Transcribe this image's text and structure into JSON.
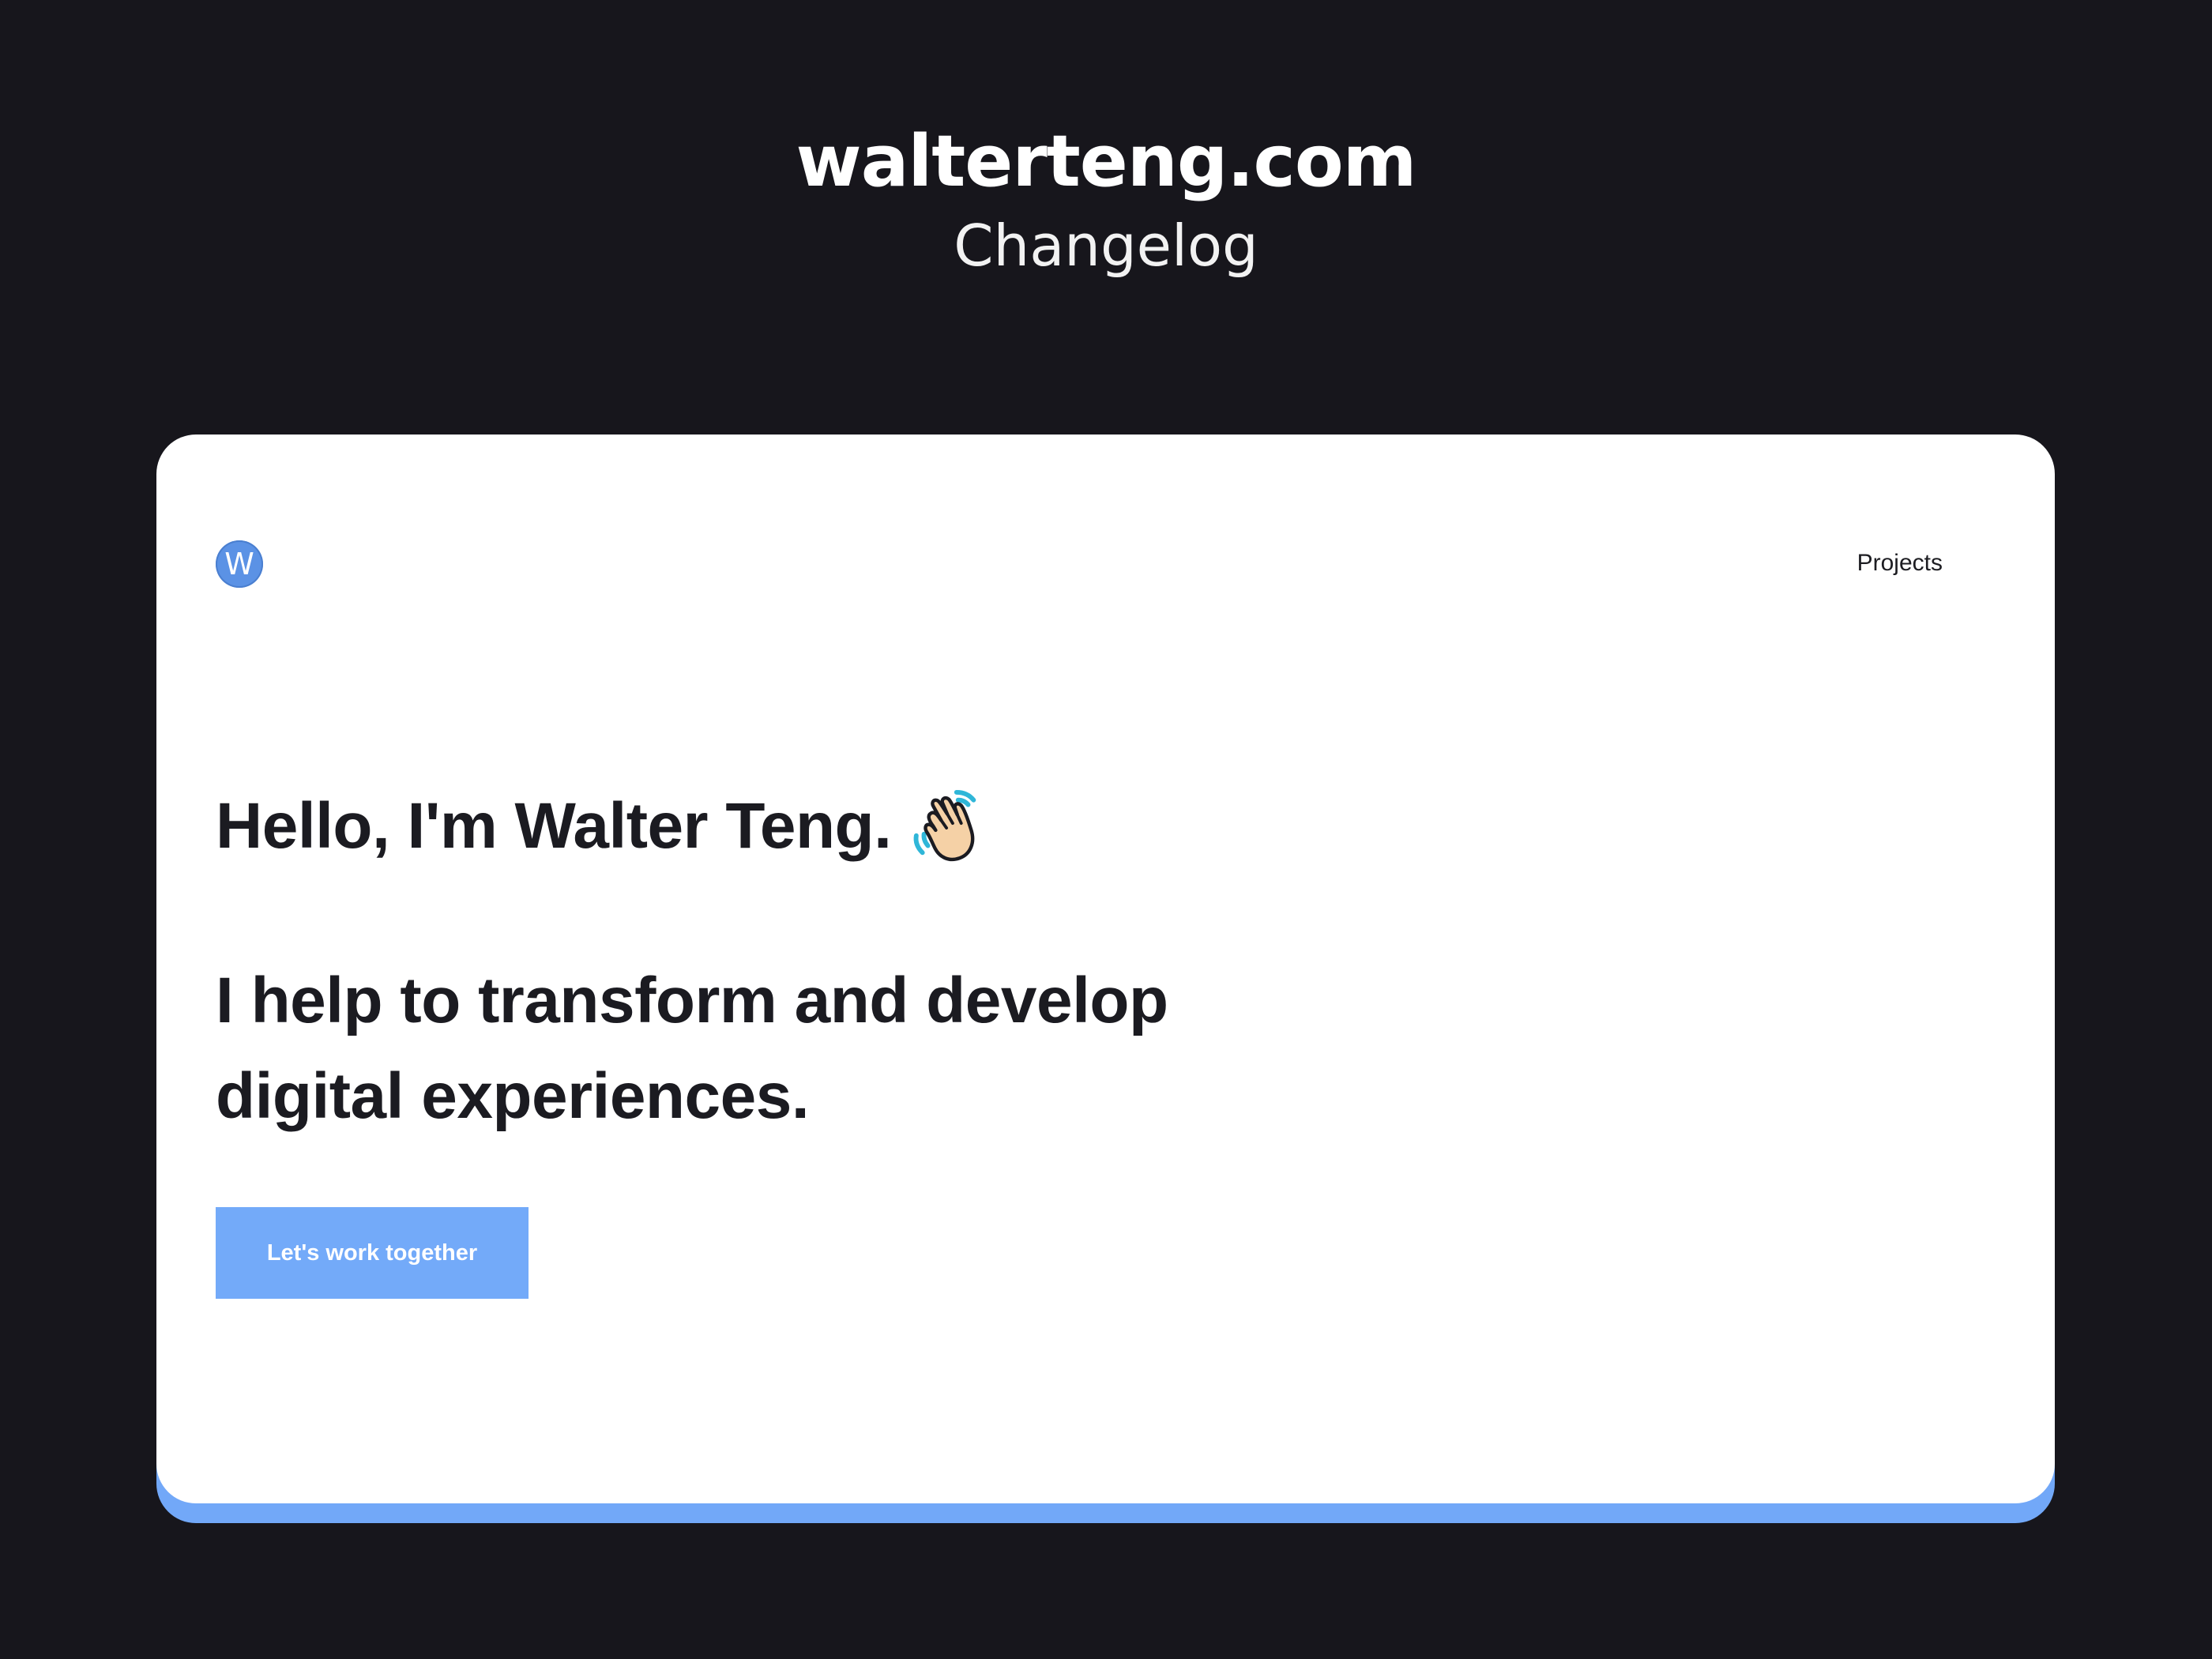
{
  "header": {
    "site_title": "walterteng.com",
    "subtitle": "Changelog"
  },
  "site": {
    "logo_letter": "W",
    "nav": {
      "projects_label": "Projects"
    },
    "hero": {
      "greeting": "Hello, I'm Walter Teng.",
      "greeting_icon": "waving-hand-icon",
      "tagline_line1": "I help to transform and develop",
      "tagline_line2": "digital experiences.",
      "cta_label": "Let's work together"
    }
  },
  "colors": {
    "page_background": "#17161c",
    "card_background": "#ffffff",
    "accent_blue": "#73aaf9",
    "logo_blue": "#5b92e5",
    "text_dark": "#1b1b21"
  }
}
